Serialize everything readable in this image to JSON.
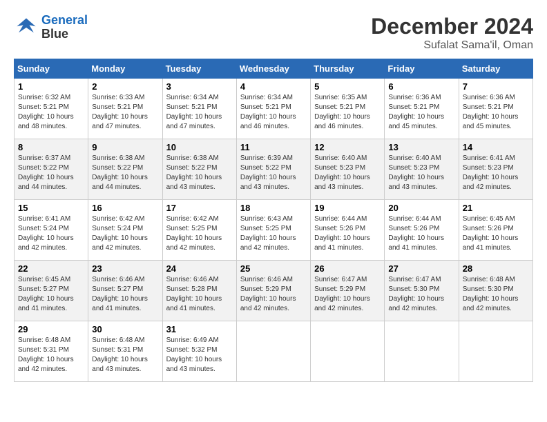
{
  "logo": {
    "line1": "General",
    "line2": "Blue"
  },
  "header": {
    "month": "December 2024",
    "location": "Sufalat Sama'il, Oman"
  },
  "weekdays": [
    "Sunday",
    "Monday",
    "Tuesday",
    "Wednesday",
    "Thursday",
    "Friday",
    "Saturday"
  ],
  "weeks": [
    [
      {
        "day": "1",
        "info": "Sunrise: 6:32 AM\nSunset: 5:21 PM\nDaylight: 10 hours\nand 48 minutes."
      },
      {
        "day": "2",
        "info": "Sunrise: 6:33 AM\nSunset: 5:21 PM\nDaylight: 10 hours\nand 47 minutes."
      },
      {
        "day": "3",
        "info": "Sunrise: 6:34 AM\nSunset: 5:21 PM\nDaylight: 10 hours\nand 47 minutes."
      },
      {
        "day": "4",
        "info": "Sunrise: 6:34 AM\nSunset: 5:21 PM\nDaylight: 10 hours\nand 46 minutes."
      },
      {
        "day": "5",
        "info": "Sunrise: 6:35 AM\nSunset: 5:21 PM\nDaylight: 10 hours\nand 46 minutes."
      },
      {
        "day": "6",
        "info": "Sunrise: 6:36 AM\nSunset: 5:21 PM\nDaylight: 10 hours\nand 45 minutes."
      },
      {
        "day": "7",
        "info": "Sunrise: 6:36 AM\nSunset: 5:21 PM\nDaylight: 10 hours\nand 45 minutes."
      }
    ],
    [
      {
        "day": "8",
        "info": "Sunrise: 6:37 AM\nSunset: 5:22 PM\nDaylight: 10 hours\nand 44 minutes."
      },
      {
        "day": "9",
        "info": "Sunrise: 6:38 AM\nSunset: 5:22 PM\nDaylight: 10 hours\nand 44 minutes."
      },
      {
        "day": "10",
        "info": "Sunrise: 6:38 AM\nSunset: 5:22 PM\nDaylight: 10 hours\nand 43 minutes."
      },
      {
        "day": "11",
        "info": "Sunrise: 6:39 AM\nSunset: 5:22 PM\nDaylight: 10 hours\nand 43 minutes."
      },
      {
        "day": "12",
        "info": "Sunrise: 6:40 AM\nSunset: 5:23 PM\nDaylight: 10 hours\nand 43 minutes."
      },
      {
        "day": "13",
        "info": "Sunrise: 6:40 AM\nSunset: 5:23 PM\nDaylight: 10 hours\nand 43 minutes."
      },
      {
        "day": "14",
        "info": "Sunrise: 6:41 AM\nSunset: 5:23 PM\nDaylight: 10 hours\nand 42 minutes."
      }
    ],
    [
      {
        "day": "15",
        "info": "Sunrise: 6:41 AM\nSunset: 5:24 PM\nDaylight: 10 hours\nand 42 minutes."
      },
      {
        "day": "16",
        "info": "Sunrise: 6:42 AM\nSunset: 5:24 PM\nDaylight: 10 hours\nand 42 minutes."
      },
      {
        "day": "17",
        "info": "Sunrise: 6:42 AM\nSunset: 5:25 PM\nDaylight: 10 hours\nand 42 minutes."
      },
      {
        "day": "18",
        "info": "Sunrise: 6:43 AM\nSunset: 5:25 PM\nDaylight: 10 hours\nand 42 minutes."
      },
      {
        "day": "19",
        "info": "Sunrise: 6:44 AM\nSunset: 5:26 PM\nDaylight: 10 hours\nand 41 minutes."
      },
      {
        "day": "20",
        "info": "Sunrise: 6:44 AM\nSunset: 5:26 PM\nDaylight: 10 hours\nand 41 minutes."
      },
      {
        "day": "21",
        "info": "Sunrise: 6:45 AM\nSunset: 5:26 PM\nDaylight: 10 hours\nand 41 minutes."
      }
    ],
    [
      {
        "day": "22",
        "info": "Sunrise: 6:45 AM\nSunset: 5:27 PM\nDaylight: 10 hours\nand 41 minutes."
      },
      {
        "day": "23",
        "info": "Sunrise: 6:46 AM\nSunset: 5:27 PM\nDaylight: 10 hours\nand 41 minutes."
      },
      {
        "day": "24",
        "info": "Sunrise: 6:46 AM\nSunset: 5:28 PM\nDaylight: 10 hours\nand 41 minutes."
      },
      {
        "day": "25",
        "info": "Sunrise: 6:46 AM\nSunset: 5:29 PM\nDaylight: 10 hours\nand 42 minutes."
      },
      {
        "day": "26",
        "info": "Sunrise: 6:47 AM\nSunset: 5:29 PM\nDaylight: 10 hours\nand 42 minutes."
      },
      {
        "day": "27",
        "info": "Sunrise: 6:47 AM\nSunset: 5:30 PM\nDaylight: 10 hours\nand 42 minutes."
      },
      {
        "day": "28",
        "info": "Sunrise: 6:48 AM\nSunset: 5:30 PM\nDaylight: 10 hours\nand 42 minutes."
      }
    ],
    [
      {
        "day": "29",
        "info": "Sunrise: 6:48 AM\nSunset: 5:31 PM\nDaylight: 10 hours\nand 42 minutes."
      },
      {
        "day": "30",
        "info": "Sunrise: 6:48 AM\nSunset: 5:31 PM\nDaylight: 10 hours\nand 43 minutes."
      },
      {
        "day": "31",
        "info": "Sunrise: 6:49 AM\nSunset: 5:32 PM\nDaylight: 10 hours\nand 43 minutes."
      },
      null,
      null,
      null,
      null
    ]
  ]
}
